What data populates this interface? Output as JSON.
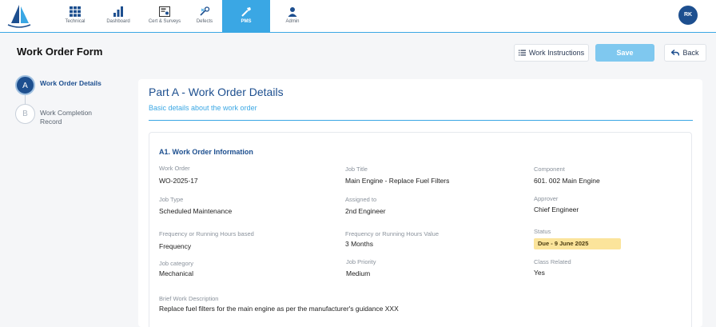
{
  "nav": {
    "items": [
      {
        "label": "Technical",
        "icon": "grid-icon"
      },
      {
        "label": "Dashboard",
        "icon": "bar-chart-icon"
      },
      {
        "label": "Cert & Surveys",
        "icon": "certificate-icon"
      },
      {
        "label": "Defects",
        "icon": "defects-icon"
      },
      {
        "label": "PMS",
        "icon": "wrench-icon"
      },
      {
        "label": "Admin",
        "icon": "admin-user-icon"
      }
    ],
    "active": "PMS",
    "avatar": "RK"
  },
  "header": {
    "title": "Work Order Form",
    "work_instructions_label": "Work Instructions",
    "save_label": "Save",
    "back_label": "Back"
  },
  "stepper": {
    "steps": [
      {
        "letter": "A",
        "label": "Work Order Details"
      },
      {
        "letter": "B",
        "label": "Work Completion Record"
      }
    ]
  },
  "part": {
    "title": "Part A - Work Order Details",
    "subtitle": "Basic details about the work order",
    "section_title": "A1. Work Order Information",
    "fields": {
      "work_order": {
        "label": "Work Order",
        "value": "WO-2025-17"
      },
      "job_title": {
        "label": "Job Title",
        "value": "Main Engine - Replace Fuel Filters"
      },
      "component": {
        "label": "Component",
        "value": "601. 002 Main Engine"
      },
      "job_type": {
        "label": "Job Type",
        "value": "Scheduled Maintenance"
      },
      "assigned_to": {
        "label": "Assigned to",
        "value": "2nd Engineer"
      },
      "approver": {
        "label": "Approver",
        "value": "Chief Engineer"
      },
      "frequency_basis": {
        "label": "Frequency or Running Hours based",
        "value": "Frequency"
      },
      "frequency_value": {
        "label": "Frequency or Running Hours Value",
        "value": "3 Months"
      },
      "status": {
        "label": "Status",
        "value": "Due - 9 June 2025"
      },
      "job_category": {
        "label": "Job category",
        "value": "Mechanical"
      },
      "job_priority": {
        "label": "Job Priority",
        "value": "Medium"
      },
      "class_related": {
        "label": "Class Related",
        "value": "Yes"
      },
      "brief_description": {
        "label": "Brief Work Description",
        "value": "Replace fuel filters for the main engine as per the manufacturer's guidance XXX"
      }
    }
  },
  "colors": {
    "primary": "#1d4f8f",
    "accent": "#3aa7e4",
    "status_badge": "#fbe49b"
  }
}
